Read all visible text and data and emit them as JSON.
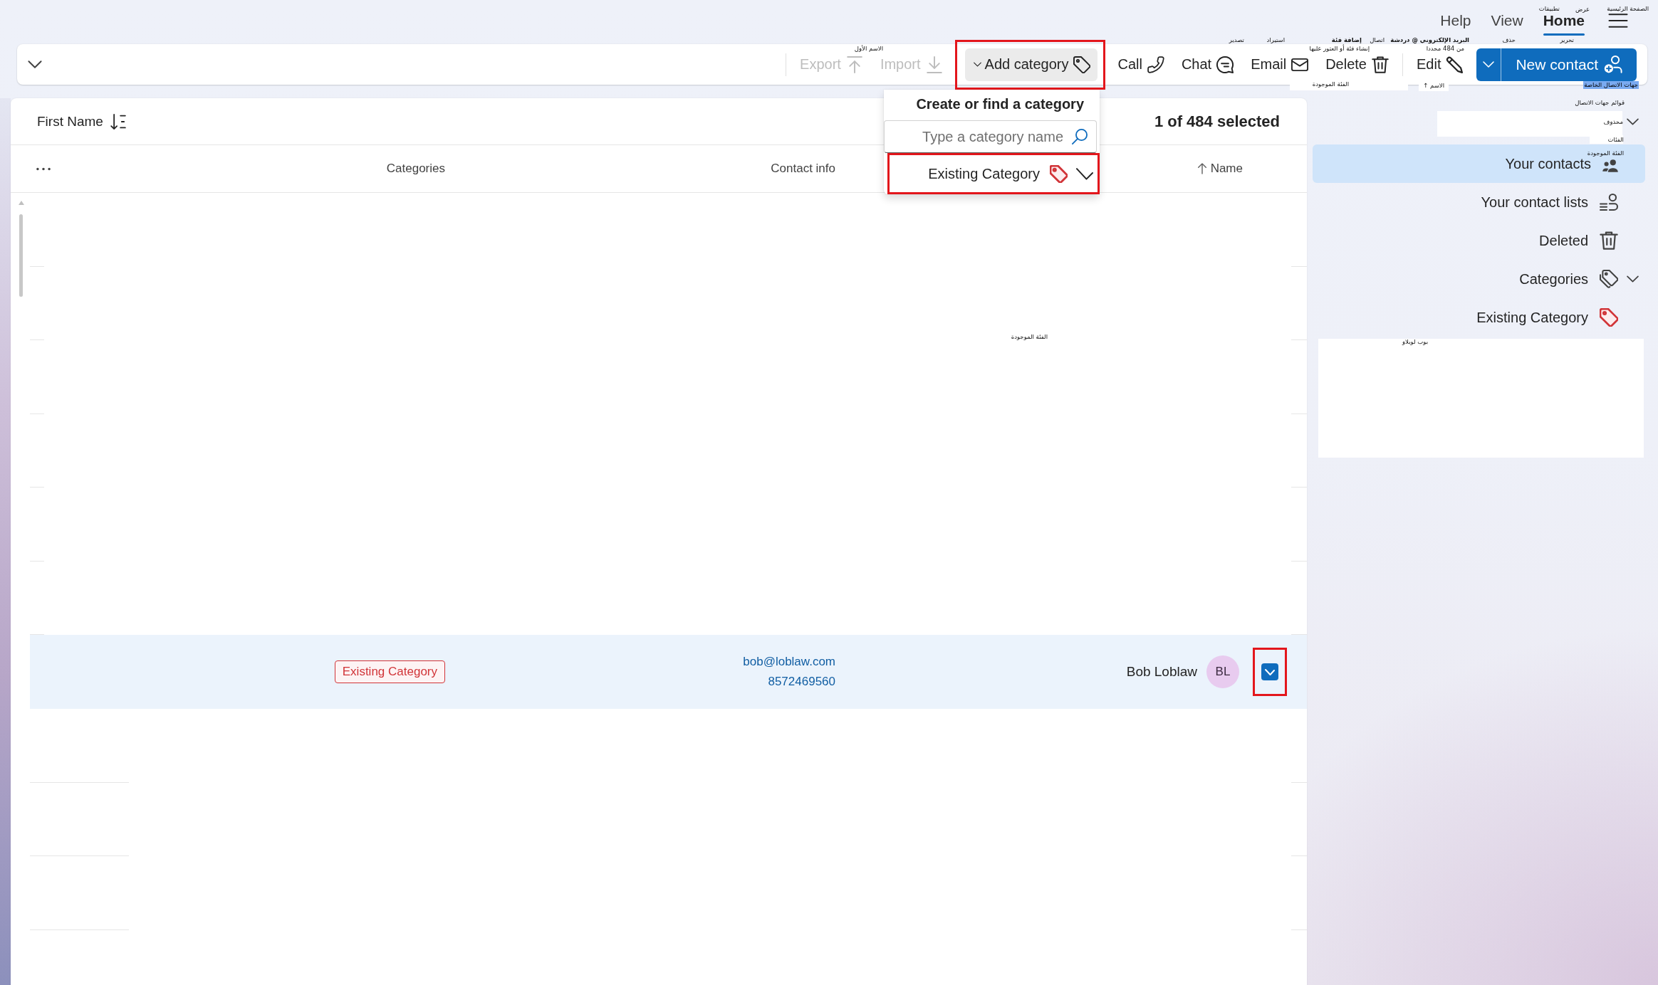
{
  "app_tabs": [
    {
      "label": "Home",
      "selected": true
    },
    {
      "label": "View",
      "selected": false
    },
    {
      "label": "Help",
      "selected": false
    }
  ],
  "ribbon": {
    "items": [
      {
        "kind": "split",
        "label": "New contact",
        "disabled": false
      },
      {
        "kind": "button",
        "label": "Edit",
        "disabled": false
      },
      {
        "kind": "separator"
      },
      {
        "kind": "button",
        "label": "Delete",
        "disabled": false
      },
      {
        "kind": "button",
        "label": "Email",
        "disabled": false
      },
      {
        "kind": "button",
        "label": "Chat",
        "disabled": false
      },
      {
        "kind": "button",
        "label": "Call",
        "disabled": false
      },
      {
        "kind": "menu",
        "label": "Add category",
        "disabled": false,
        "expanded": true
      },
      {
        "kind": "button",
        "label": "Import",
        "disabled": true
      },
      {
        "kind": "button",
        "label": "Export",
        "disabled": true
      },
      {
        "kind": "separator"
      }
    ]
  },
  "category_menu": {
    "title": "Create or find a category",
    "search": {
      "placeholder": "Type a category name"
    },
    "items": [
      {
        "label": "Existing Category",
        "checked": true,
        "color": "#d13438"
      }
    ]
  },
  "list_header": {
    "selection": "1 of 484 selected",
    "sort_button": "First Name"
  },
  "table": {
    "columns": [
      {
        "label": "Name",
        "sorted": true
      },
      {
        "label": "Contact info",
        "sorted": false
      },
      {
        "label": "Categories",
        "sorted": false
      }
    ],
    "rows": [
      {
        "selected": true,
        "initials": "BL",
        "name": "Bob Loblaw",
        "email": "bob@loblaw.com",
        "phone": "8572469560",
        "categories": [
          {
            "label": "Existing Category",
            "color": "#d13438"
          }
        ]
      }
    ]
  },
  "sidebar": {
    "items": [
      {
        "label": "Your contacts",
        "selected": true
      },
      {
        "label": "Your contact lists",
        "selected": false
      },
      {
        "label": "Deleted",
        "selected": false
      },
      {
        "label": "Categories",
        "selected": false,
        "expanded": true,
        "children": [
          {
            "label": "Existing Category",
            "selected": false,
            "color": "#d13438"
          }
        ]
      }
    ]
  },
  "overlay_labels": [
    {
      "text": "الصفحة الرئيسية",
      "kind": "plain"
    },
    {
      "text": "عرض",
      "kind": "plain"
    },
    {
      "text": "تطبيقات",
      "kind": "plain"
    },
    {
      "text": "تحرير",
      "kind": "plain"
    },
    {
      "text": "حذف",
      "kind": "plain"
    },
    {
      "text": "البريد الإلكتروني @ دردشة",
      "kind": "bold"
    },
    {
      "text": "اتصال",
      "kind": "plain"
    },
    {
      "text": "إضافة فئة",
      "kind": "bold"
    },
    {
      "text": "استيراد",
      "kind": "plain"
    },
    {
      "text": "تصدير",
      "kind": "plain"
    },
    {
      "text": "من 484 محددا",
      "kind": "plain"
    },
    {
      "text": "إنشاء فئة أو العثور عليها",
      "kind": "plain"
    },
    {
      "text": "الاسم الأول",
      "kind": "plain"
    },
    {
      "text": "جهات الاتصال الخاصة",
      "kind": "highlighted"
    },
    {
      "text": "الاسم ↑",
      "kind": "boxed"
    },
    {
      "text": "الفئة الموجودة",
      "kind": "plain"
    },
    {
      "text": "قوائم جهات الاتصال",
      "kind": "plain"
    },
    {
      "text": "محذوف",
      "kind": "plain"
    },
    {
      "text": "الفئات",
      "kind": "plain"
    },
    {
      "text": "الفئة الموجودة",
      "kind": "plain"
    },
    {
      "text": "بوب لوبلاو",
      "kind": "plain"
    },
    {
      "text": "الفئة الموجودة",
      "kind": "plain"
    }
  ]
}
